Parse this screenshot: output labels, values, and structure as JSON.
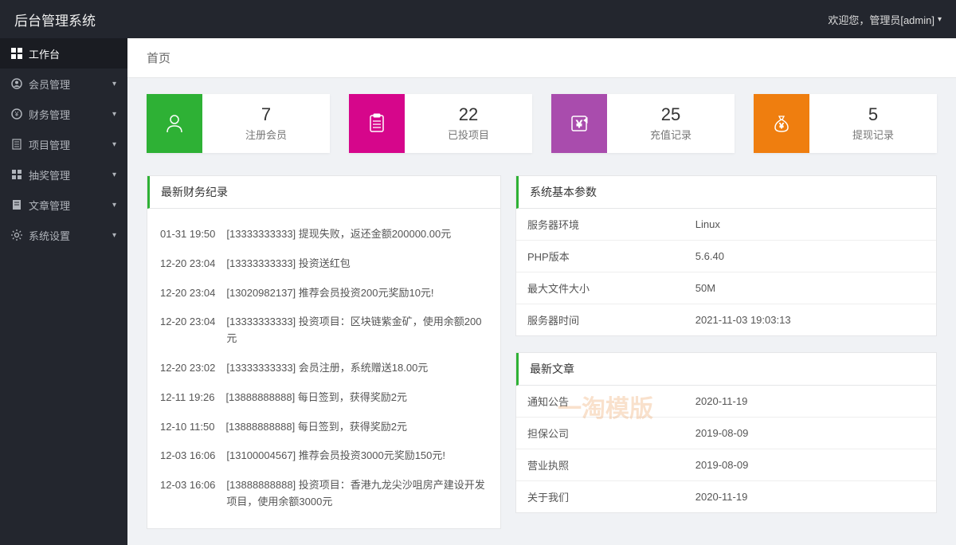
{
  "header": {
    "logo": "后台管理系统",
    "welcome": "欢迎您，管理员[admin]"
  },
  "sidebar": {
    "items": [
      {
        "label": "工作台",
        "icon": "dashboard",
        "active": true,
        "expandable": false
      },
      {
        "label": "会员管理",
        "icon": "user",
        "active": false,
        "expandable": true
      },
      {
        "label": "财务管理",
        "icon": "finance",
        "active": false,
        "expandable": true
      },
      {
        "label": "项目管理",
        "icon": "project",
        "active": false,
        "expandable": true
      },
      {
        "label": "抽奖管理",
        "icon": "lottery",
        "active": false,
        "expandable": true
      },
      {
        "label": "文章管理",
        "icon": "article",
        "active": false,
        "expandable": true
      },
      {
        "label": "系统设置",
        "icon": "gear",
        "active": false,
        "expandable": true
      }
    ]
  },
  "tab": {
    "title": "首页"
  },
  "stats": [
    {
      "value": "7",
      "label": "注册会员",
      "color": "green",
      "icon": "user"
    },
    {
      "value": "22",
      "label": "已投项目",
      "color": "pink",
      "icon": "clipboard"
    },
    {
      "value": "25",
      "label": "充值记录",
      "color": "purple",
      "icon": "yen"
    },
    {
      "value": "5",
      "label": "提现记录",
      "color": "orange",
      "icon": "bag"
    }
  ],
  "finance_panel": {
    "title": "最新财务纪录",
    "rows": [
      {
        "time": "01-31 19:50",
        "text": "[13333333333] 提现失败，返还金额200000.00元"
      },
      {
        "time": "12-20 23:04",
        "text": "[13333333333] 投资送红包"
      },
      {
        "time": "12-20 23:04",
        "text": "[13020982137] 推荐会员投资200元奖励10元!"
      },
      {
        "time": "12-20 23:04",
        "text": "[13333333333] 投资项目：区块链紫金矿，使用余额200元"
      },
      {
        "time": "12-20 23:02",
        "text": "[13333333333] 会员注册，系统赠送18.00元"
      },
      {
        "time": "12-11 19:26",
        "text": "[13888888888] 每日签到，获得奖励2元"
      },
      {
        "time": "12-10 11:50",
        "text": "[13888888888] 每日签到，获得奖励2元"
      },
      {
        "time": "12-03 16:06",
        "text": "[13100004567] 推荐会员投资3000元奖励150元!"
      },
      {
        "time": "12-03 16:06",
        "text": "[13888888888] 投资项目：香港九龙尖沙咀房产建设开发项目，使用余额3000元"
      }
    ]
  },
  "sysinfo_panel": {
    "title": "系统基本参数",
    "rows": [
      {
        "k": "服务器环境",
        "v": "Linux"
      },
      {
        "k": "PHP版本",
        "v": "5.6.40"
      },
      {
        "k": "最大文件大小",
        "v": "50M"
      },
      {
        "k": "服务器时间",
        "v": "2021-11-03 19:03:13"
      }
    ]
  },
  "articles_panel": {
    "title": "最新文章",
    "rows": [
      {
        "k": "通知公告",
        "v": "2020-11-19"
      },
      {
        "k": "担保公司",
        "v": "2019-08-09"
      },
      {
        "k": "营业执照",
        "v": "2019-08-09"
      },
      {
        "k": "关于我们",
        "v": "2020-11-19"
      }
    ]
  },
  "watermark": "一淘模版"
}
